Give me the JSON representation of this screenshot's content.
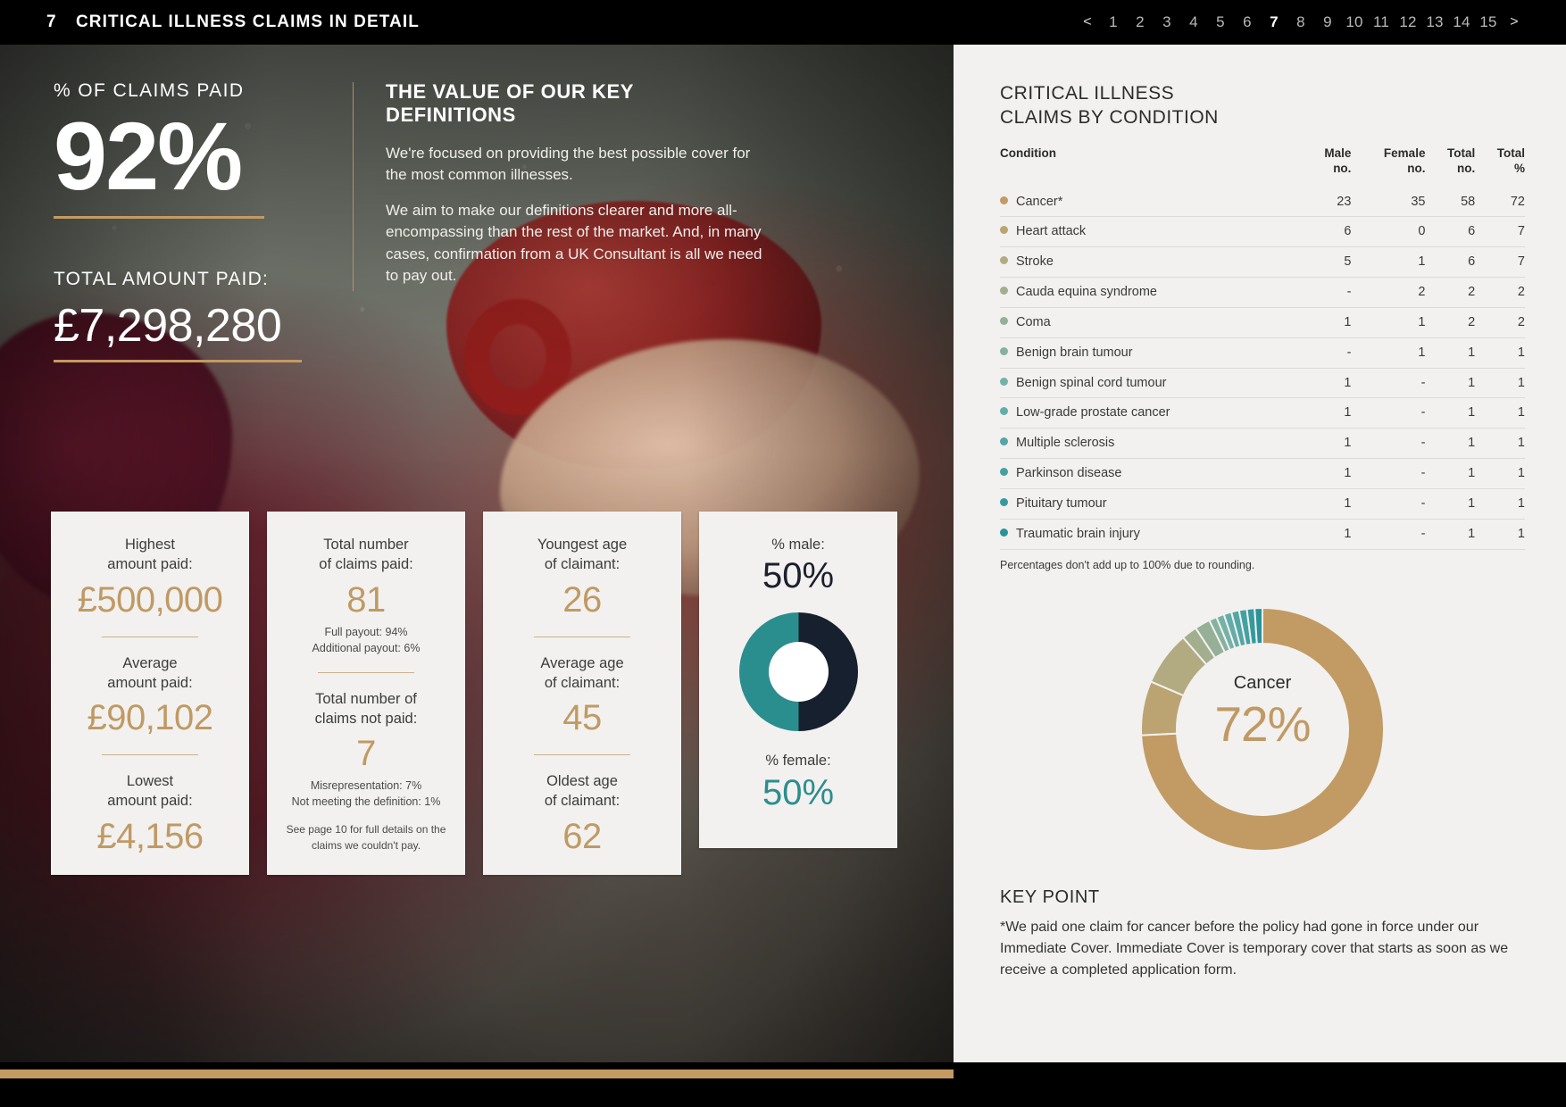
{
  "header": {
    "page_number": "7",
    "title": "CRITICAL ILLNESS CLAIMS IN DETAIL",
    "prev": "<",
    "next": ">",
    "pages": [
      "1",
      "2",
      "3",
      "4",
      "5",
      "6",
      "7",
      "8",
      "9",
      "10",
      "11",
      "12",
      "13",
      "14",
      "15"
    ],
    "active_page": "7"
  },
  "hero": {
    "claims_paid_label": "% OF CLAIMS PAID",
    "claims_paid_value": "92%",
    "total_amount_label": "TOTAL AMOUNT PAID:",
    "total_amount_value": "£7,298,280"
  },
  "definitions": {
    "title": "THE VALUE OF OUR KEY DEFINITIONS",
    "para1": "We're focused on providing the best possible cover for the most common illnesses.",
    "para2": "We aim to make our definitions clearer and more all-encompassing than the rest of the market. And, in many cases, confirmation from a UK Consultant is all we need to pay out."
  },
  "cards": [
    {
      "label1": "Highest\namount paid:",
      "value1": "£500,000",
      "label2": "Average\namount paid:",
      "value2": "£90,102",
      "label3": "Lowest\namount paid:",
      "value3": "£4,156"
    },
    {
      "label1": "Total number\nof claims paid:",
      "value1": "81",
      "sub1": "Full payout: 94%\nAdditional payout: 6%",
      "label2": "Total number of\nclaims not paid:",
      "value2": "7",
      "sub2": "Misrepresentation: 7%\nNot meeting the definition: 1%",
      "sub3": "See page 10 for full details on the\nclaims we couldn't pay."
    },
    {
      "label1": "Youngest age\nof claimant:",
      "value1": "26",
      "label2": "Average age\nof claimant:",
      "value2": "45",
      "label3": "Oldest age\nof claimant:",
      "value3": "62"
    },
    {
      "male_label": "% male:",
      "male_value": "50%",
      "female_label": "% female:",
      "female_value": "50%"
    }
  ],
  "panel": {
    "title": "CRITICAL ILLNESS\nCLAIMS BY CONDITION",
    "columns": [
      "Condition",
      "Male\nno.",
      "Female\nno.",
      "Total\nno.",
      "Total\n%"
    ],
    "note": "Percentages don't add up to 100% due to rounding.",
    "keypoint_title": "KEY POINT",
    "keypoint_text": "*We paid one claim for cancer before the policy had gone in force under our Immediate Cover. Immediate Cover is temporary cover that starts as soon as we receive a completed application form."
  },
  "chart_data": [
    {
      "type": "table",
      "title": "Critical illness claims by condition",
      "columns": [
        "Condition",
        "Male no.",
        "Female no.",
        "Total no.",
        "Total %"
      ],
      "rows": [
        {
          "condition": "Cancer*",
          "male": "23",
          "female": "35",
          "total": "58",
          "pct": "72",
          "color": "#c29a63"
        },
        {
          "condition": "Heart attack",
          "male": "6",
          "female": "0",
          "total": "6",
          "pct": "7",
          "color": "#bba472"
        },
        {
          "condition": "Stroke",
          "male": "5",
          "female": "1",
          "total": "6",
          "pct": "7",
          "color": "#b2ab82"
        },
        {
          "condition": "Cauda equina syndrome",
          "male": "-",
          "female": "2",
          "total": "2",
          "pct": "2",
          "color": "#a3ae8e"
        },
        {
          "condition": "Coma",
          "male": "1",
          "female": "1",
          "total": "2",
          "pct": "2",
          "color": "#95b096"
        },
        {
          "condition": "Benign brain tumour",
          "male": "-",
          "female": "1",
          "total": "1",
          "pct": "1",
          "color": "#85b2a0"
        },
        {
          "condition": "Benign spinal cord tumour",
          "male": "1",
          "female": "-",
          "total": "1",
          "pct": "1",
          "color": "#74b2a7"
        },
        {
          "condition": "Low-grade prostate cancer",
          "male": "1",
          "female": "-",
          "total": "1",
          "pct": "1",
          "color": "#63ada9"
        },
        {
          "condition": "Multiple sclerosis",
          "male": "1",
          "female": "-",
          "total": "1",
          "pct": "1",
          "color": "#52a6a6"
        },
        {
          "condition": "Parkinson disease",
          "male": "1",
          "female": "-",
          "total": "1",
          "pct": "1",
          "color": "#44a0a2"
        },
        {
          "condition": "Pituitary tumour",
          "male": "1",
          "female": "-",
          "total": "1",
          "pct": "1",
          "color": "#369a9d"
        },
        {
          "condition": "Traumatic brain injury",
          "male": "1",
          "female": "-",
          "total": "1",
          "pct": "1",
          "color": "#2a9398"
        }
      ]
    },
    {
      "type": "pie",
      "title": "Critical illness claims by condition",
      "center_label": "Cancer",
      "center_value": "72%",
      "labels": [
        "Cancer*",
        "Heart attack",
        "Stroke",
        "Cauda equina syndrome",
        "Coma",
        "Benign brain tumour",
        "Benign spinal cord tumour",
        "Low-grade prostate cancer",
        "Multiple sclerosis",
        "Parkinson disease",
        "Pituitary tumour",
        "Traumatic brain injury"
      ],
      "values": [
        72,
        7,
        7,
        2,
        2,
        1,
        1,
        1,
        1,
        1,
        1,
        1
      ],
      "colors": [
        "#c29a63",
        "#bba472",
        "#b2ab82",
        "#a3ae8e",
        "#95b096",
        "#85b2a0",
        "#74b2a7",
        "#63ada9",
        "#52a6a6",
        "#44a0a2",
        "#369a9d",
        "#2a9398"
      ]
    },
    {
      "type": "pie",
      "title": "Gender split of claimants",
      "labels": [
        "% male",
        "% female"
      ],
      "values": [
        50,
        50
      ],
      "colors": [
        "#16202f",
        "#2b8e8e"
      ]
    }
  ]
}
